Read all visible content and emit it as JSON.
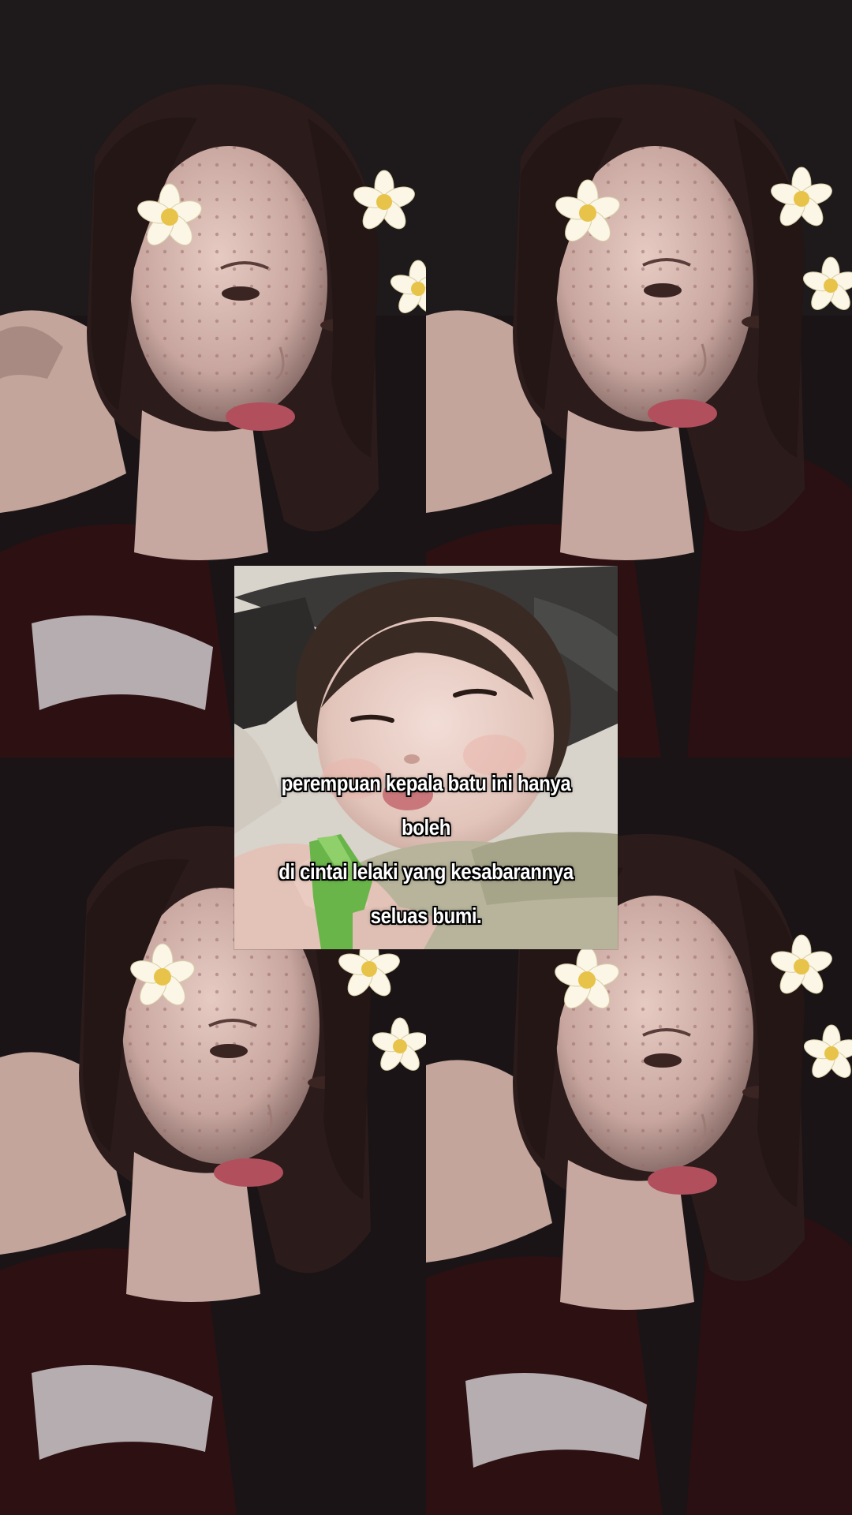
{
  "caption": {
    "line1": "perempuan kepala batu ini hanya boleh",
    "line2": "di cintai lelaki yang kesabarannya",
    "line3": "seluas bumi."
  },
  "palette": {
    "background": "#140d11",
    "skin": "#d8bcb4",
    "hair": "#2a1a18",
    "lips": "#b0505c",
    "flower_petal": "#fbf6e6",
    "flower_center": "#e8c34a",
    "caption_text": "#ffffff",
    "caption_outline": "#000000"
  },
  "icons": {
    "decoration": "frangipani-flower-icon"
  }
}
